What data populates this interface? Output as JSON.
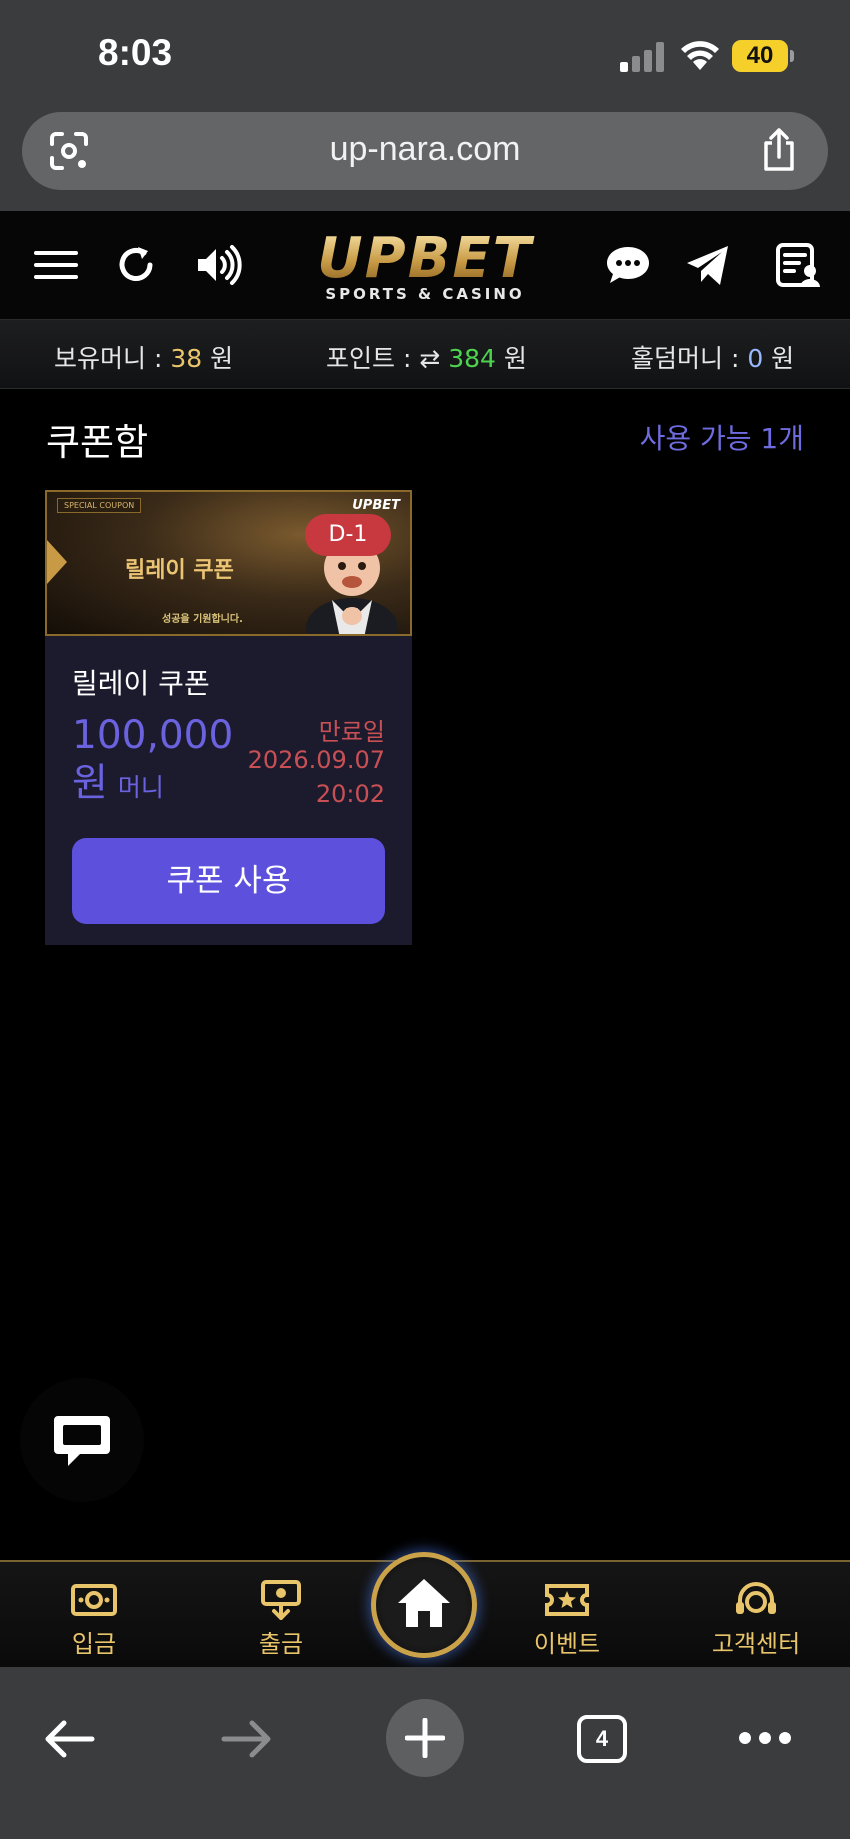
{
  "status_bar": {
    "time": "8:03",
    "battery": "40"
  },
  "browser": {
    "url": "up-nara.com",
    "tab_count": "4"
  },
  "header": {
    "logo_main": "UPBET",
    "logo_sub": "SPORTS & CASINO",
    "icons": [
      "menu-icon",
      "refresh-icon",
      "sound-icon",
      "chat-icon",
      "telegram-icon",
      "notice-icon"
    ]
  },
  "balance": {
    "money_label": "보유머니 : ",
    "money_value": "38",
    "money_unit": " 원",
    "point_label": "포인트 : ",
    "point_value": "384",
    "point_unit": " 원",
    "holdem_label": "홀덤머니 : ",
    "holdem_value": "0",
    "holdem_unit": " 원"
  },
  "coupons": {
    "title": "쿠폰함",
    "available": "사용 가능 1개",
    "items": [
      {
        "banner_tag": "SPECIAL COUPON",
        "banner_logo": "UPBET",
        "banner_title": "릴레이 쿠폰",
        "banner_sub": "성공을 기원합니다.",
        "dday": "D-1",
        "name": "릴레이 쿠폰",
        "amount": "100,000 원",
        "type": "머니",
        "expire_label": "만료일",
        "expire_date": "2026.09.07",
        "expire_time": "20:02",
        "button": "쿠폰 사용"
      }
    ]
  },
  "bottom_nav": {
    "deposit": "입금",
    "withdraw": "출금",
    "event": "이벤트",
    "support": "고객센터"
  },
  "colors": {
    "accent": "#5d50dc",
    "gold": "#e8c46a",
    "expire": "#c85055"
  }
}
